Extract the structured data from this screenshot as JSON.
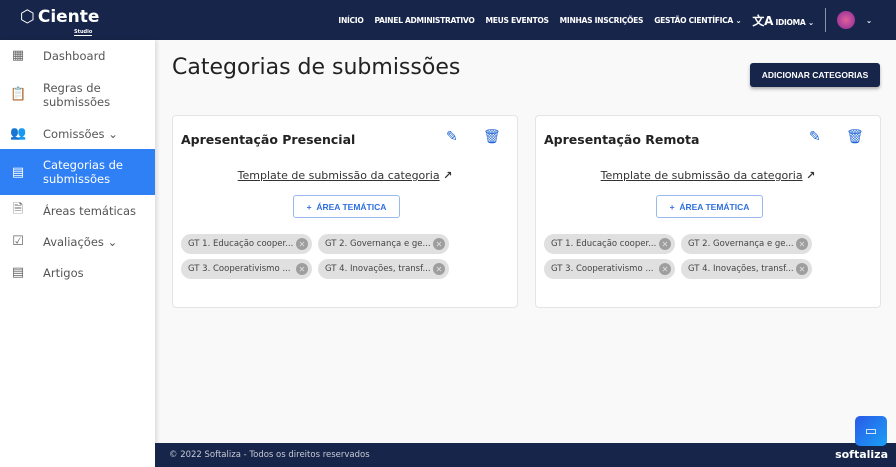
{
  "nav": {
    "logo": "Ciente",
    "logo_sub": "Studio",
    "items": [
      "INÍCIO",
      "PAINEL ADMINISTRATIVO",
      "MEUS EVENTOS",
      "MINHAS INSCRIÇÕES",
      "GESTÃO CIENTÍFICA"
    ],
    "language": "IDIOMA"
  },
  "sidebar": {
    "items": [
      {
        "label": "Dashboard",
        "icon": "dashboard-icon"
      },
      {
        "label": "Regras de submissões",
        "icon": "clipboard-icon"
      },
      {
        "label": "Comissões",
        "icon": "people-icon"
      },
      {
        "label": "Categorias de submissões",
        "icon": "calendar-icon"
      },
      {
        "label": "Áreas temáticas",
        "icon": "note-add-icon"
      },
      {
        "label": "Avaliações",
        "icon": "checklist-icon"
      },
      {
        "label": "Artigos",
        "icon": "library-icon"
      }
    ]
  },
  "main": {
    "title": "Categorias de submissões",
    "add_button": "ADICIONAR CATEGORIAS",
    "cards": [
      {
        "title": "Apresentação Presencial",
        "template_link": "Template de submissão da categoria",
        "area_button": "ÁREA TEMÁTICA",
        "chips": [
          "GT 1. Educação cooper...",
          "GT 2. Governança e ge...",
          "GT 3. Cooperativismo ...",
          "GT 4. Inovações, transf..."
        ]
      },
      {
        "title": "Apresentação Remota",
        "template_link": "Template de submissão da categoria",
        "area_button": "ÁREA TEMÁTICA",
        "chips": [
          "GT 1. Educação cooper...",
          "GT 2. Governança e ge...",
          "GT 3. Cooperativismo ...",
          "GT 4. Inovações, transf..."
        ]
      }
    ]
  },
  "footer": {
    "copyright": "© 2022 Softaliza - Todos os direitos reservados",
    "brand": "softaliza"
  },
  "colors": {
    "navy": "#17254a",
    "accent": "#2f7ff5"
  }
}
